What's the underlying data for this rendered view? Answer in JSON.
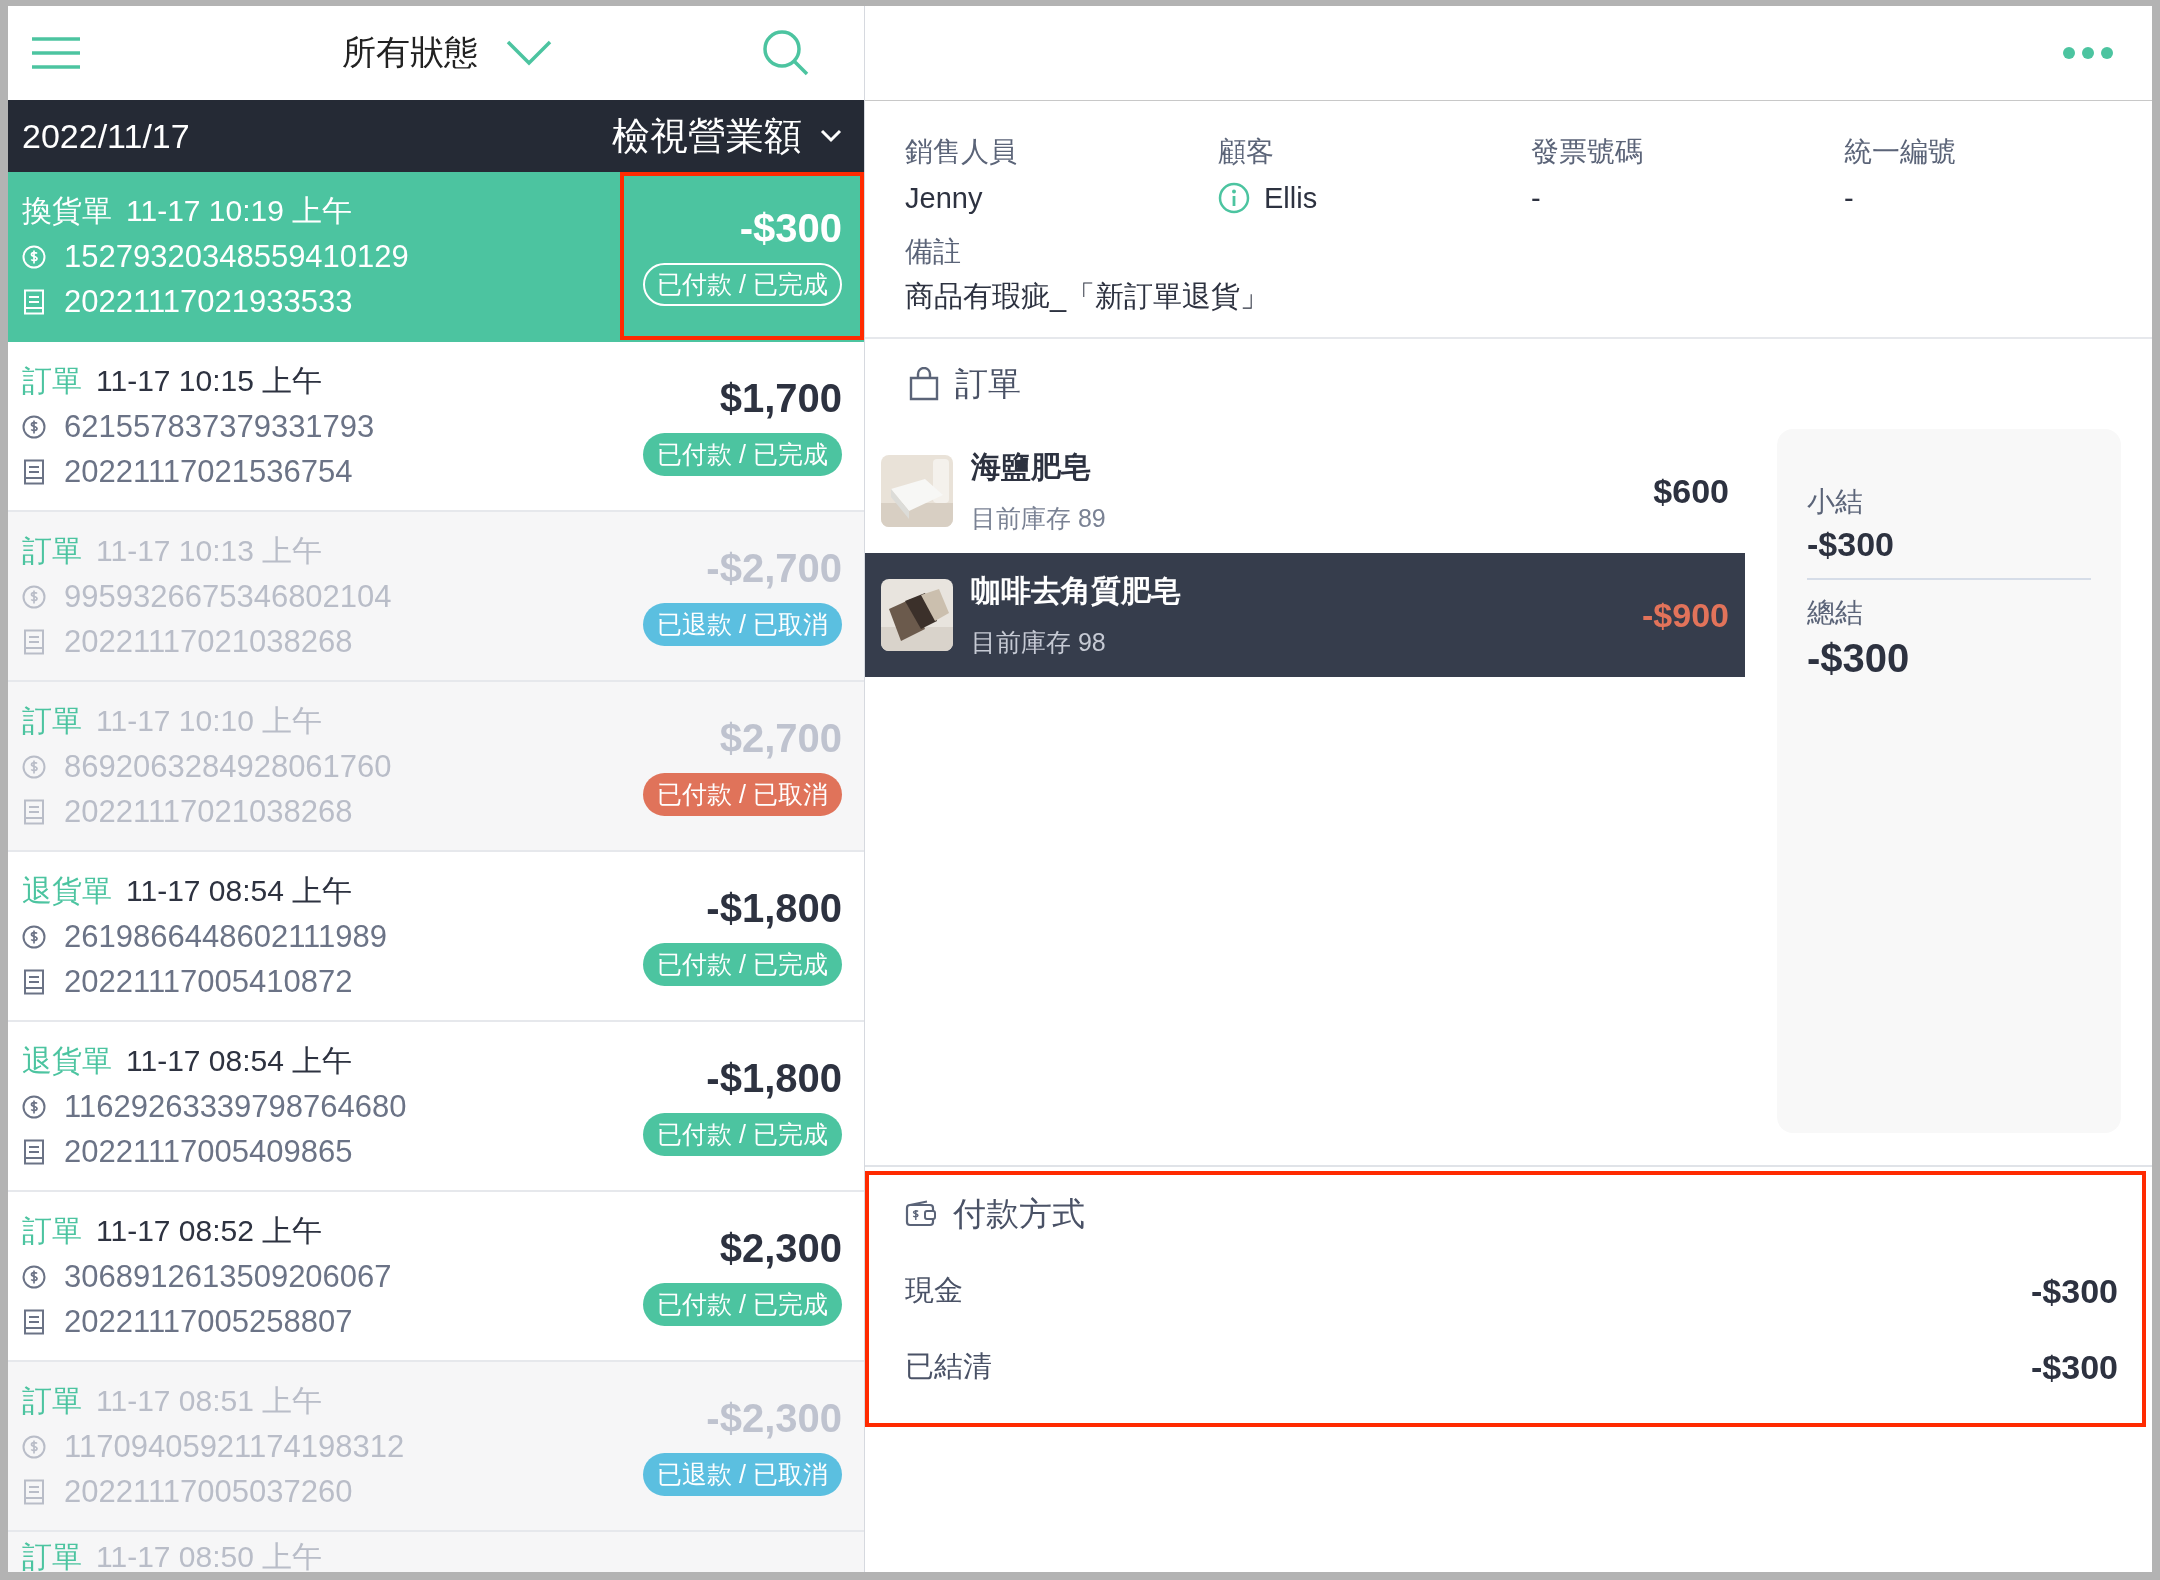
{
  "top_bar": {
    "filter": "所有狀態"
  },
  "date_bar": {
    "date": "2022/11/17",
    "sales_toggle": "檢視營業額"
  },
  "orders": [
    {
      "type": "換貨單",
      "time": "11-17 10:19 上午",
      "payment_id": "15279320348559410129",
      "order_no": "20221117021933533",
      "amount": "-$300",
      "status": "已付款 / 已完成",
      "selected": true,
      "cancelled": false,
      "highlighted": true
    },
    {
      "type": "訂單",
      "time": "11-17 10:15 上午",
      "payment_id": "621557837379331793",
      "order_no": "20221117021536754",
      "amount": "$1,700",
      "status": "已付款 / 已完成",
      "color": "#4cc4a0",
      "selected": false,
      "cancelled": false,
      "highlighted": false
    },
    {
      "type": "訂單",
      "time": "11-17 10:13 上午",
      "payment_id": "9959326675346802104",
      "order_no": "20221117021038268",
      "amount": "-$2,700",
      "status": "已退款 / 已取消",
      "color": "#5bbfe0",
      "selected": false,
      "cancelled": true,
      "highlighted": false
    },
    {
      "type": "訂單",
      "time": "11-17 10:10 上午",
      "payment_id": "8692063284928061760",
      "order_no": "20221117021038268",
      "amount": "$2,700",
      "status": "已付款 / 已取消",
      "color": "#e0735a",
      "selected": false,
      "cancelled": true,
      "highlighted": false
    },
    {
      "type": "退貨單",
      "time": "11-17 08:54 上午",
      "payment_id": "2619866448602111989",
      "order_no": "20221117005410872",
      "amount": "-$1,800",
      "status": "已付款 / 已完成",
      "color": "#4cc4a0",
      "selected": false,
      "cancelled": false,
      "highlighted": false
    },
    {
      "type": "退貨單",
      "time": "11-17 08:54 上午",
      "payment_id": "11629263339798764680",
      "order_no": "20221117005409865",
      "amount": "-$1,800",
      "status": "已付款 / 已完成",
      "color": "#4cc4a0",
      "selected": false,
      "cancelled": false,
      "highlighted": false
    },
    {
      "type": "訂單",
      "time": "11-17 08:52 上午",
      "payment_id": "3068912613509206067",
      "order_no": "20221117005258807",
      "amount": "$2,300",
      "status": "已付款 / 已完成",
      "color": "#4cc4a0",
      "selected": false,
      "cancelled": false,
      "highlighted": false
    },
    {
      "type": "訂單",
      "time": "11-17 08:51 上午",
      "payment_id": "11709405921174198312",
      "order_no": "20221117005037260",
      "amount": "-$2,300",
      "status": "已退款 / 已取消",
      "color": "#5bbfe0",
      "selected": false,
      "cancelled": true,
      "highlighted": false
    }
  ],
  "partial_order": {
    "type": "訂單",
    "time": "11-17 08:50 上午"
  },
  "details": {
    "fields": [
      {
        "label": "銷售人員",
        "value": "Jenny",
        "info_icon": false
      },
      {
        "label": "顧客",
        "value": "Ellis",
        "info_icon": true
      },
      {
        "label": "發票號碼",
        "value": "-",
        "info_icon": false
      },
      {
        "label": "統一編號",
        "value": "-",
        "info_icon": false
      }
    ],
    "note": {
      "label": "備註",
      "value": "商品有瑕疵_「新訂單退貨」"
    }
  },
  "order_section": {
    "title": "訂單",
    "items": [
      {
        "name": "海鹽肥皂",
        "stock": "目前庫存 89",
        "price": "$600",
        "selected": false
      },
      {
        "name": "咖啡去角質肥皂",
        "stock": "目前庫存 98",
        "price": "-$900",
        "selected": true
      }
    ],
    "summary": [
      {
        "label": "小結",
        "value": "-$300"
      },
      {
        "label": "總結",
        "value": "-$300"
      }
    ]
  },
  "payment": {
    "title": "付款方式",
    "highlighted": true,
    "rows": [
      {
        "label": "現金",
        "amount": "-$300"
      },
      {
        "label": "已結清",
        "amount": "-$300"
      }
    ]
  }
}
